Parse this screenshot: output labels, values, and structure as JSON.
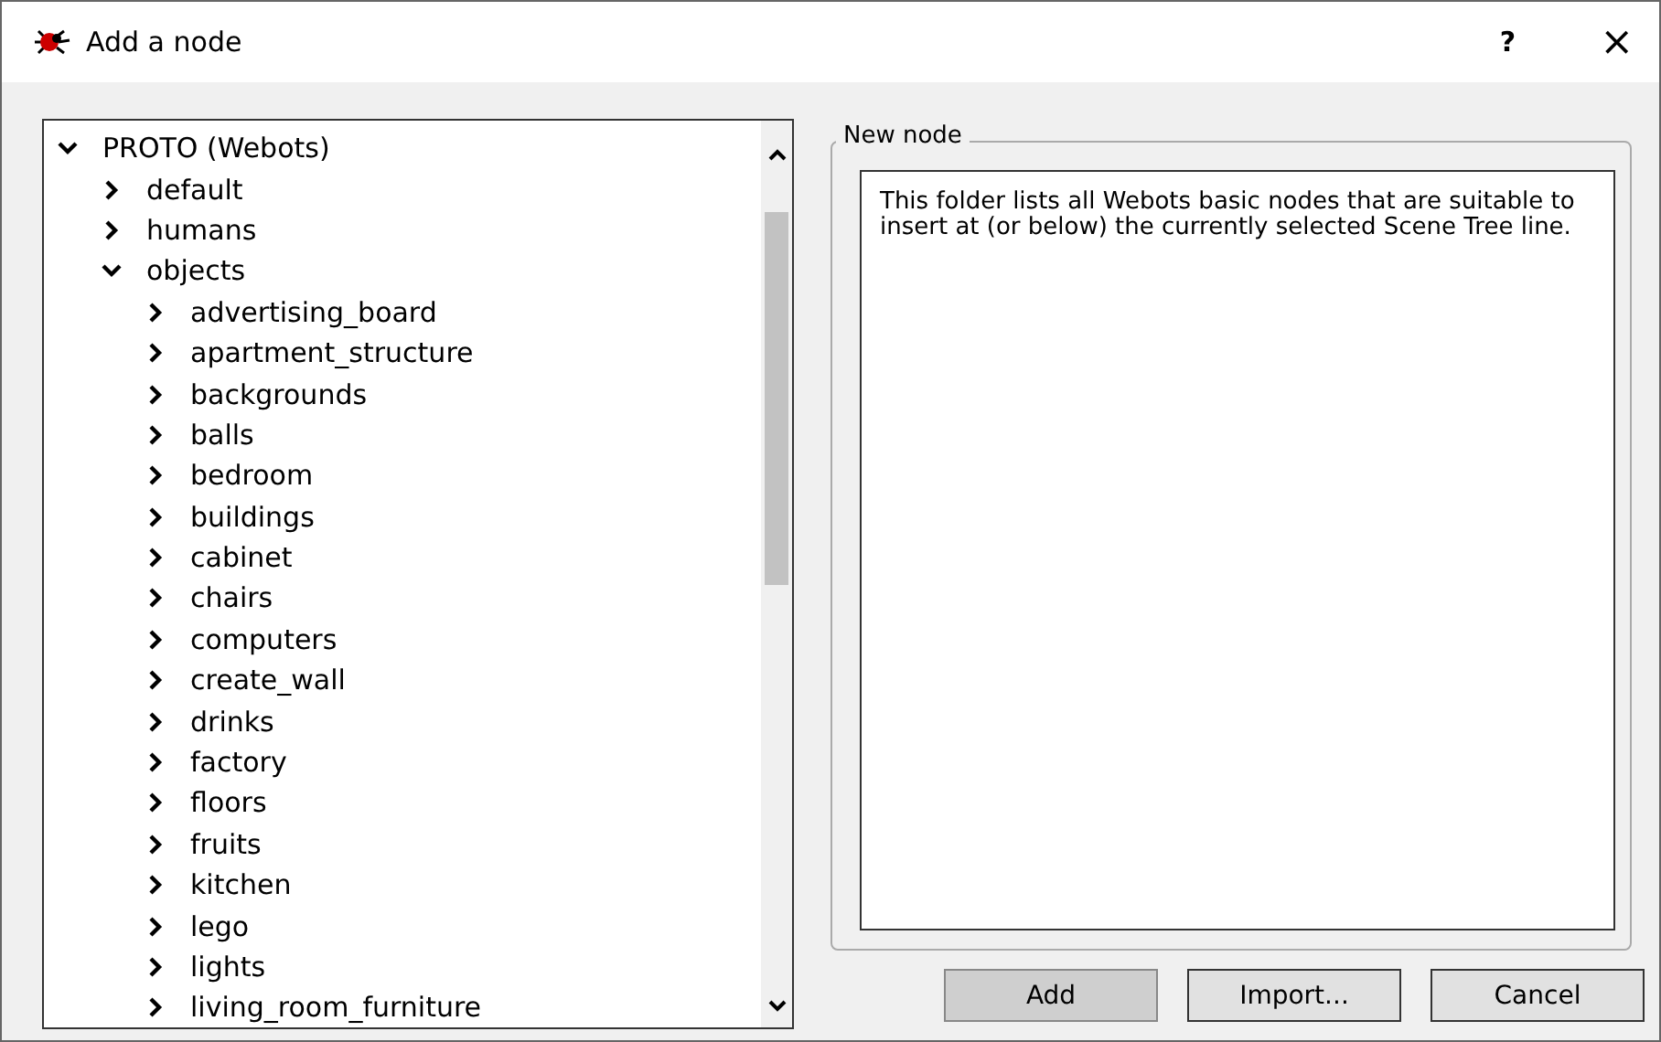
{
  "window": {
    "title": "Add a node",
    "help": "?",
    "close": "×"
  },
  "tree": {
    "items": [
      {
        "label": "PROTO (Webots)",
        "expanded": true,
        "children": [
          {
            "label": "default",
            "expanded": false
          },
          {
            "label": "humans",
            "expanded": false
          },
          {
            "label": "objects",
            "expanded": true,
            "children": [
              {
                "label": "advertising_board",
                "expanded": false
              },
              {
                "label": "apartment_structure",
                "expanded": false
              },
              {
                "label": "backgrounds",
                "expanded": false
              },
              {
                "label": "balls",
                "expanded": false
              },
              {
                "label": "bedroom",
                "expanded": false
              },
              {
                "label": "buildings",
                "expanded": false
              },
              {
                "label": "cabinet",
                "expanded": false
              },
              {
                "label": "chairs",
                "expanded": false
              },
              {
                "label": "computers",
                "expanded": false
              },
              {
                "label": "create_wall",
                "expanded": false
              },
              {
                "label": "drinks",
                "expanded": false
              },
              {
                "label": "factory",
                "expanded": false
              },
              {
                "label": "floors",
                "expanded": false
              },
              {
                "label": "fruits",
                "expanded": false
              },
              {
                "label": "kitchen",
                "expanded": false
              },
              {
                "label": "lego",
                "expanded": false
              },
              {
                "label": "lights",
                "expanded": false
              },
              {
                "label": "living_room_furniture",
                "expanded": false
              }
            ]
          }
        ]
      }
    ]
  },
  "group": {
    "title": "New node",
    "description": "This folder lists all Webots basic nodes that are suitable to insert at (or below) the currently selected Scene Tree line."
  },
  "buttons": [
    {
      "label": "Add",
      "disabled": true
    },
    {
      "label": "Import...",
      "disabled": false
    },
    {
      "label": "Cancel",
      "disabled": false
    }
  ]
}
